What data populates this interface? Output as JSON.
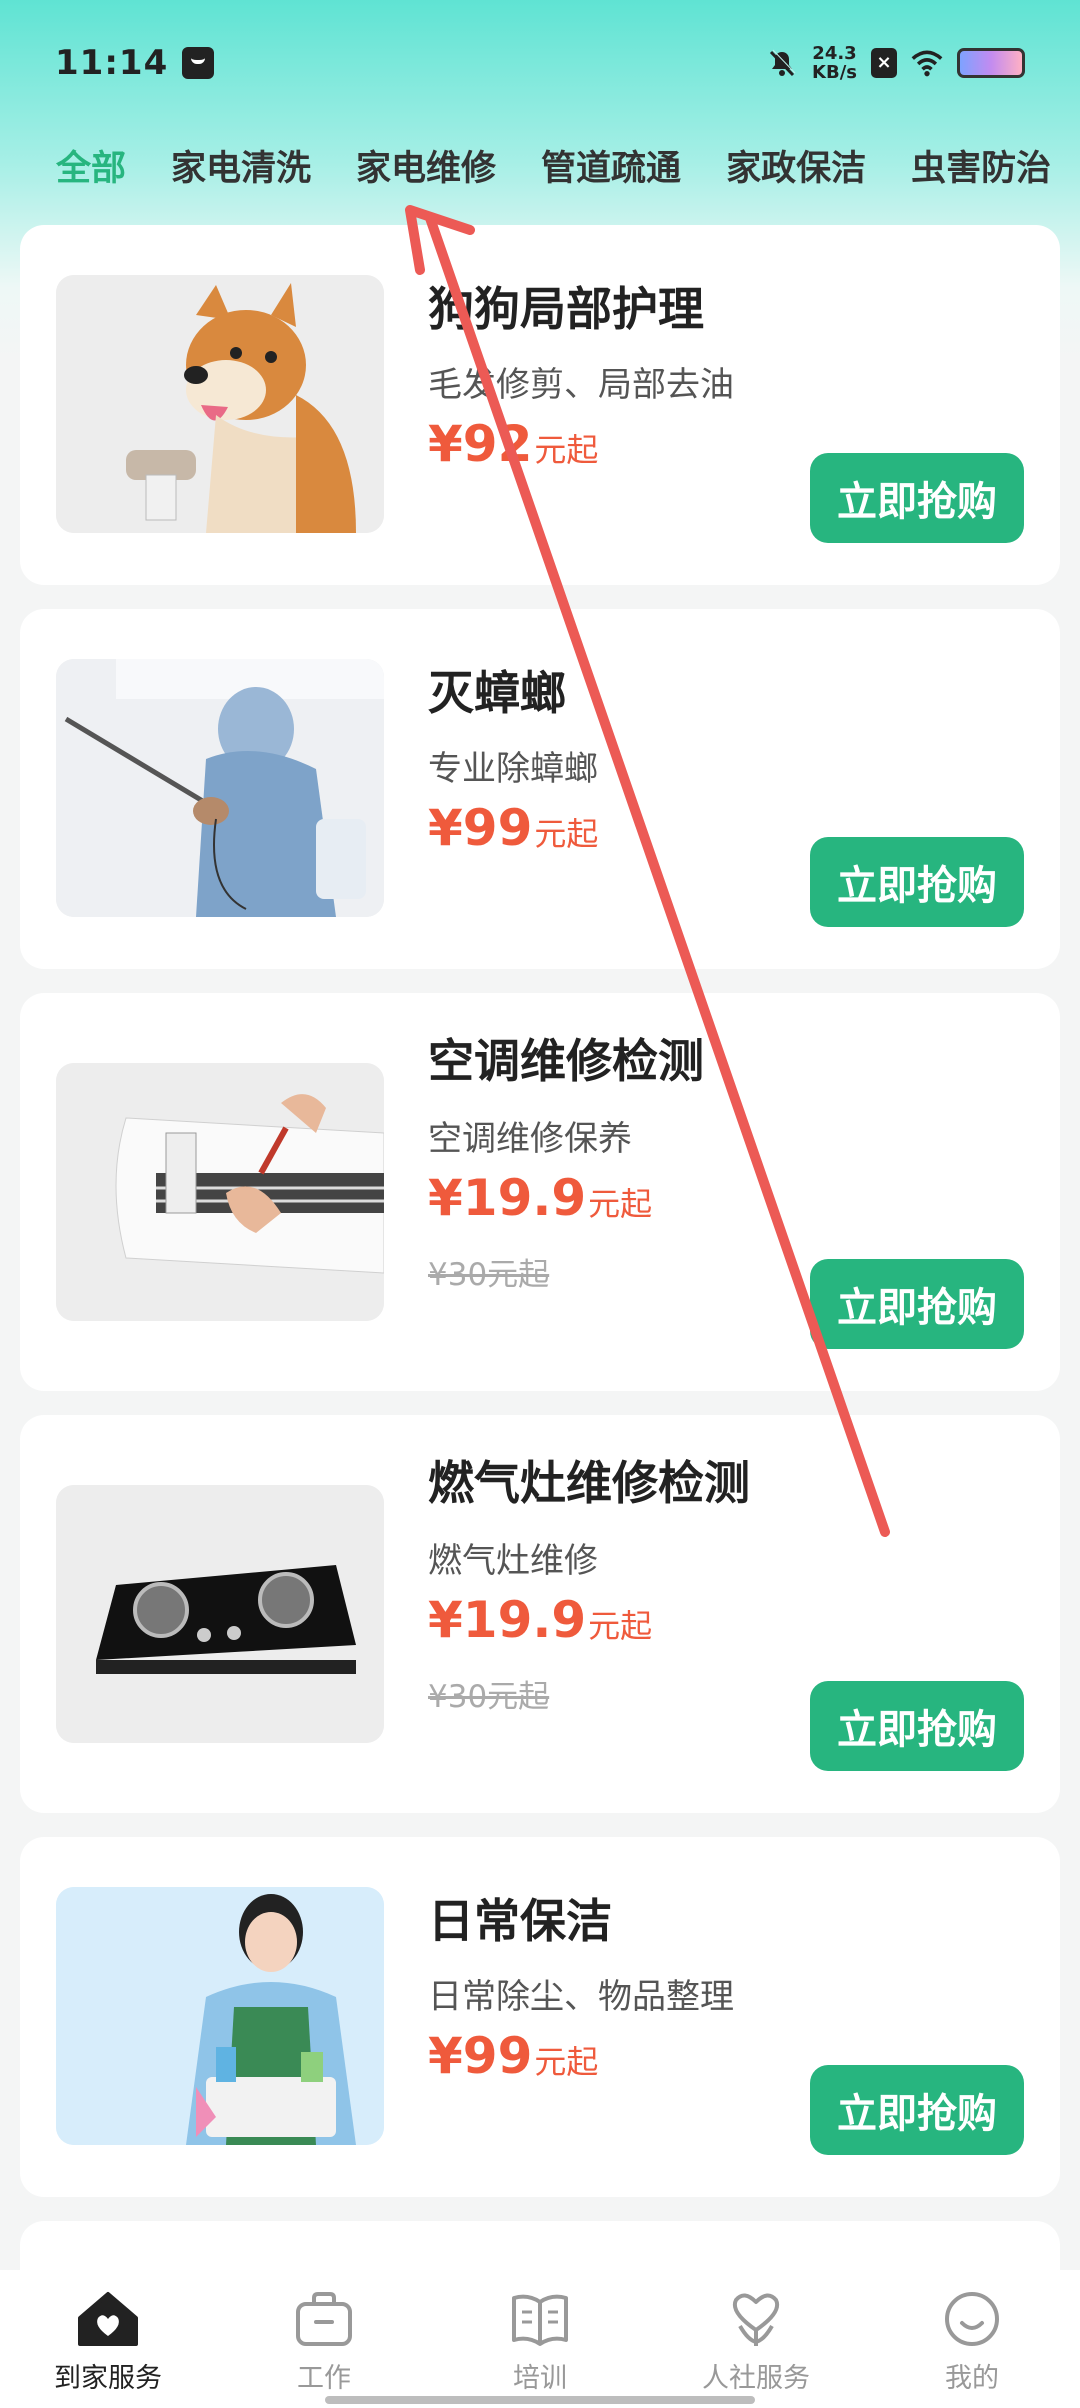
{
  "status_bar": {
    "time": "11:14",
    "net_speed_value": "24.3",
    "net_speed_unit": "KB/s"
  },
  "tabs": [
    {
      "label": "全部",
      "active": true
    },
    {
      "label": "家电清洗"
    },
    {
      "label": "家电维修"
    },
    {
      "label": "管道疏通"
    },
    {
      "label": "家政保洁"
    },
    {
      "label": "虫害防治"
    }
  ],
  "services": [
    {
      "title": "狗狗局部护理",
      "desc": "毛发修剪、局部去油",
      "price": "¥92",
      "unit": "元起",
      "button": "立即抢购"
    },
    {
      "title": "灭蟑螂",
      "desc": "专业除蟑螂",
      "price": "¥99",
      "unit": "元起",
      "button": "立即抢购"
    },
    {
      "title": "空调维修检测",
      "desc": "空调维修保养",
      "price": "¥19.9",
      "unit": "元起",
      "old_price": "¥30元起",
      "button": "立即抢购"
    },
    {
      "title": "燃气灶维修检测",
      "desc": "燃气灶维修",
      "price": "¥19.9",
      "unit": "元起",
      "old_price": "¥30元起",
      "button": "立即抢购"
    },
    {
      "title": "日常保洁",
      "desc": "日常除尘、物品整理",
      "price": "¥99",
      "unit": "元起",
      "button": "立即抢购"
    }
  ],
  "bottom_nav": [
    {
      "label": "到家服务",
      "icon": "home-heart-icon",
      "active": true
    },
    {
      "label": "工作",
      "icon": "briefcase-icon"
    },
    {
      "label": "培训",
      "icon": "book-icon"
    },
    {
      "label": "人社服务",
      "icon": "heart-person-icon"
    },
    {
      "label": "我的",
      "icon": "smile-icon"
    }
  ],
  "colors": {
    "accent": "#27b57f",
    "price": "#ef5a3c",
    "annotation_arrow": "#ec5a55"
  }
}
